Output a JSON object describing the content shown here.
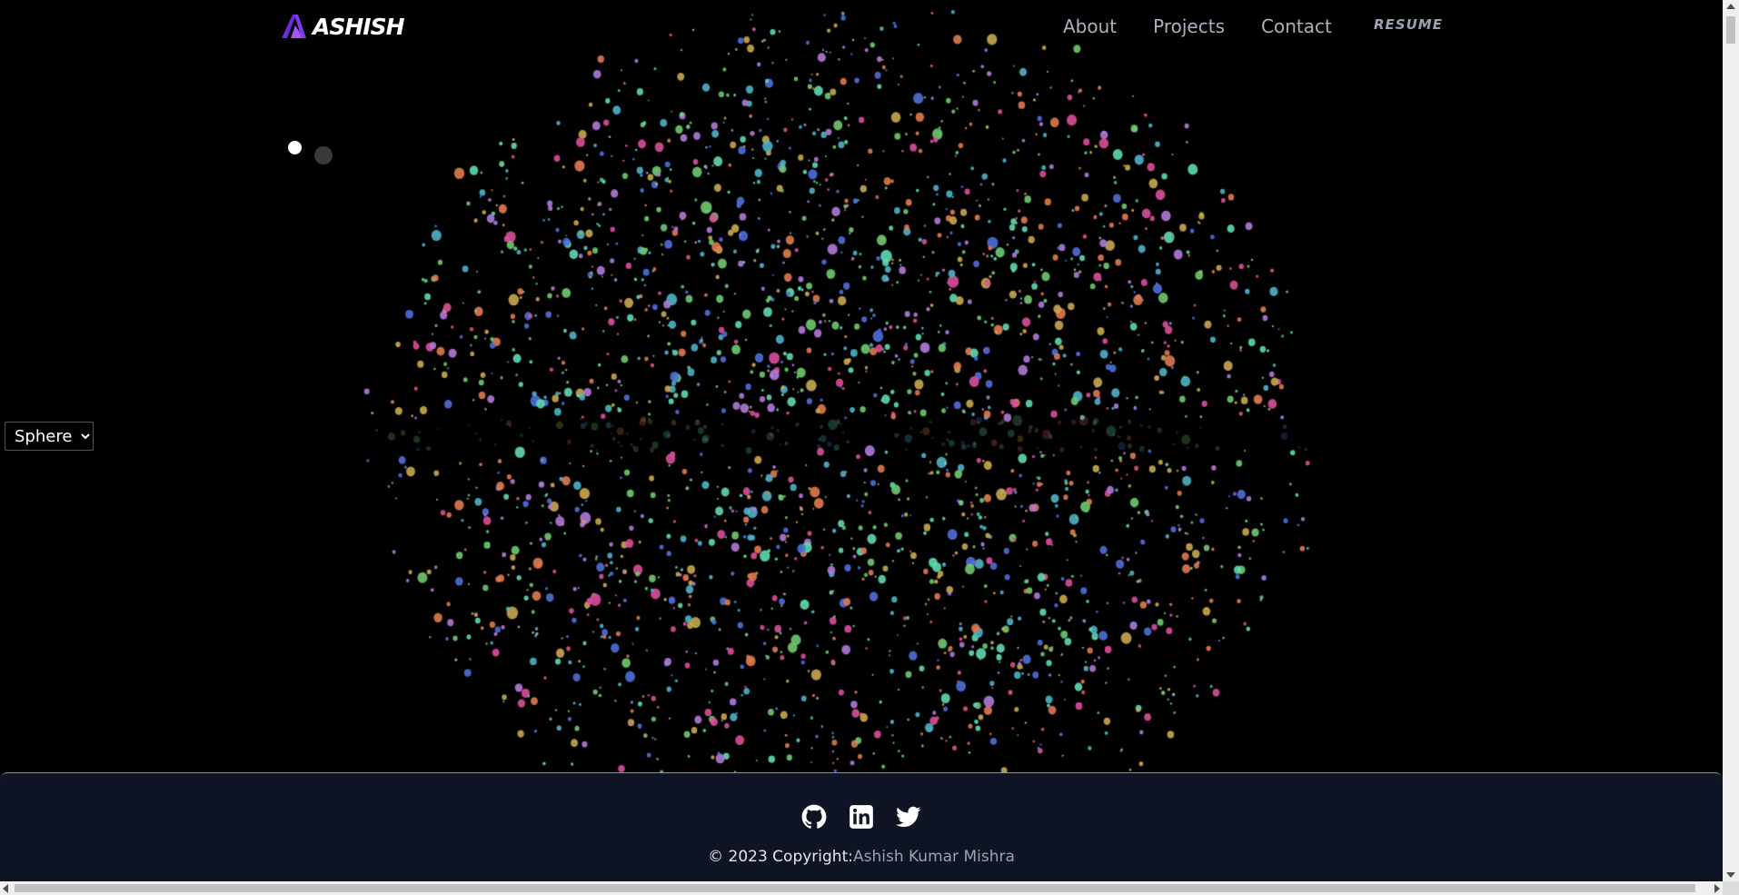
{
  "header": {
    "logo_text": "ASHISH",
    "nav": [
      "About",
      "Projects",
      "Contact"
    ],
    "resume_label": "RESUME"
  },
  "controls": {
    "shape_selected": "Sphere"
  },
  "footer": {
    "socials": [
      "github-icon",
      "linkedin-icon",
      "twitter-icon"
    ],
    "copyright_prefix": "© 2023 Copyright:",
    "copyright_name": "Ashish Kumar Mishra"
  },
  "colors": {
    "background": "#000000",
    "footer_bg": "#0f1626",
    "nav_text": "#aab2bf",
    "logo_accent": "#7c3aed",
    "particle_palette": [
      "#4fb3c9",
      "#d94f9b",
      "#c9a84f",
      "#6fc96f",
      "#4f6fd9",
      "#e07a4f",
      "#b07ad9",
      "#5fd9b0"
    ]
  }
}
